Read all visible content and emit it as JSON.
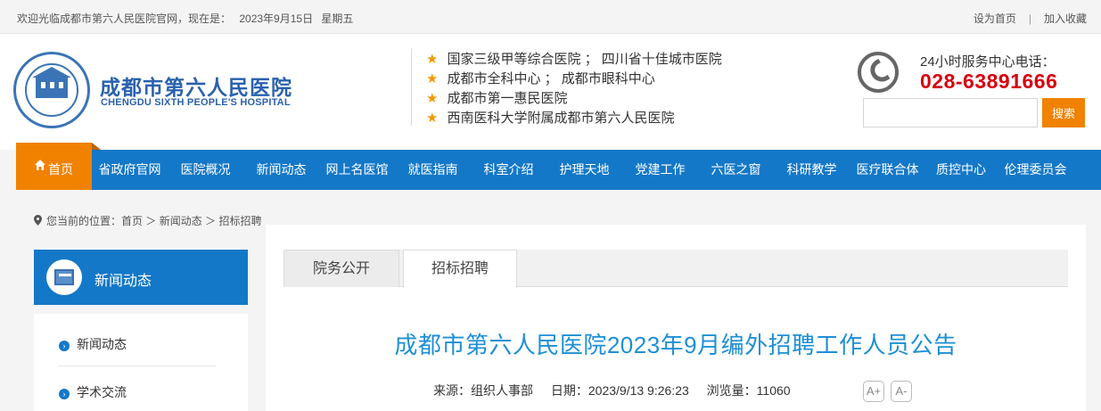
{
  "topbar": {
    "welcome": "欢迎光临成都市第六人民医院官网，现在是：",
    "date": "2023年9月15日",
    "weekday": "星期五",
    "set_home": "设为首页",
    "separator": "|",
    "bookmark": "加入收藏"
  },
  "header": {
    "logo_cn": "成都市第六人民医院",
    "logo_en": "CHENGDU SIXTH PEOPLE'S HOSPITAL",
    "features": [
      "国家三级甲等综合医院 ； 四川省十佳城市医院",
      "成都市全科中心 ； 成都市眼科中心",
      "成都市第一惠民医院",
      "西南医科大学附属成都市第六人民医院"
    ],
    "service_label": "24小时服务中心电话：",
    "service_phone": "028-63891666",
    "search_placeholder": "",
    "search_button": "搜索"
  },
  "nav": {
    "home": "首页",
    "items": [
      "省政府官网",
      "医院概况",
      "新闻动态",
      "网上名医馆",
      "就医指南",
      "科室介绍",
      "护理天地",
      "党建工作",
      "六医之窗",
      "科研教学",
      "医疗联合体",
      "质控中心",
      "伦理委员会"
    ]
  },
  "breadcrumb": {
    "prefix": "您当前的位置：",
    "items": [
      "首页",
      "新闻动态",
      "招标招聘"
    ],
    "sep": "＞"
  },
  "sidebar": {
    "title": "新闻动态",
    "items": [
      "新闻动态",
      "学术交流"
    ]
  },
  "main": {
    "tabs": [
      "院务公开",
      "招标招聘"
    ],
    "active_tab": "招标招聘",
    "article_title": "成都市第六人民医院2023年9月编外招聘工作人员公告",
    "source": "来源：组织人事部",
    "date": "日期：2023/9/13 9:26:23",
    "views": "浏览量：11060",
    "font_increase": "A+",
    "font_decrease": "A-"
  },
  "colors": {
    "primary_blue": "#1478c8",
    "accent_orange": "#f08200",
    "phone_red": "#d7000f",
    "title_blue": "#1e8fd6"
  }
}
